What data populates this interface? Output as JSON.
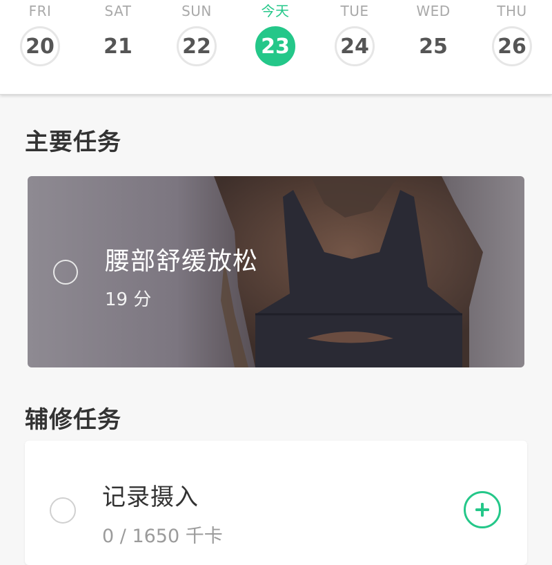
{
  "week": {
    "days": [
      {
        "label": "FRI",
        "num": "20"
      },
      {
        "label": "SAT",
        "num": "21"
      },
      {
        "label": "SUN",
        "num": "22"
      },
      {
        "label": "今天",
        "num": "23"
      },
      {
        "label": "TUE",
        "num": "24"
      },
      {
        "label": "WED",
        "num": "25"
      },
      {
        "label": "THU",
        "num": "26"
      }
    ],
    "active_index": 3
  },
  "main_tasks": {
    "title": "主要任务",
    "task": {
      "name": "腰部舒缓放松",
      "duration": "19 分"
    }
  },
  "side_tasks": {
    "title": "辅修任务",
    "task": {
      "name": "记录摄入",
      "progress": "0 / 1650 千卡",
      "action_icon": "plus-circle-icon"
    }
  },
  "colors": {
    "accent": "#24c789"
  }
}
